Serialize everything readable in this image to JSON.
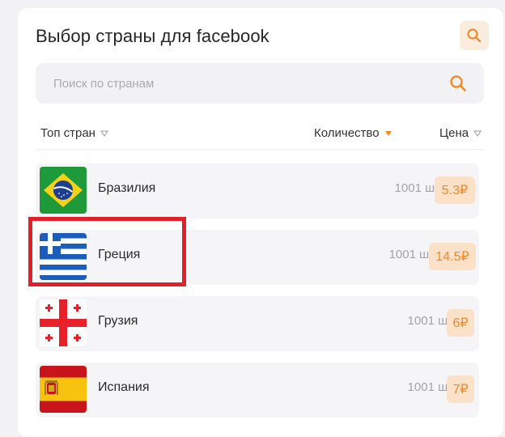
{
  "title": "Выбор страны для facebook",
  "search": {
    "placeholder": "Поиск по странам",
    "value": ""
  },
  "header": {
    "top": "Топ стран",
    "quantity": "Количество",
    "price": "Цена"
  },
  "colors": {
    "accent": "#f08a2c",
    "price_bg": "#fbe1c8",
    "highlight": "#e2202b"
  },
  "countries": [
    {
      "name": "Бразилия",
      "qty": "1001 шт",
      "price": "5.3₽",
      "flag": "brazil-flag-icon"
    },
    {
      "name": "Греция",
      "qty": "1001 шт",
      "price": "14.5₽",
      "flag": "greece-flag-icon"
    },
    {
      "name": "Грузия",
      "qty": "1001 шт",
      "price": "6₽",
      "flag": "georgia-flag-icon"
    },
    {
      "name": "Испания",
      "qty": "1001 шт",
      "price": "7₽",
      "flag": "spain-flag-icon"
    }
  ]
}
